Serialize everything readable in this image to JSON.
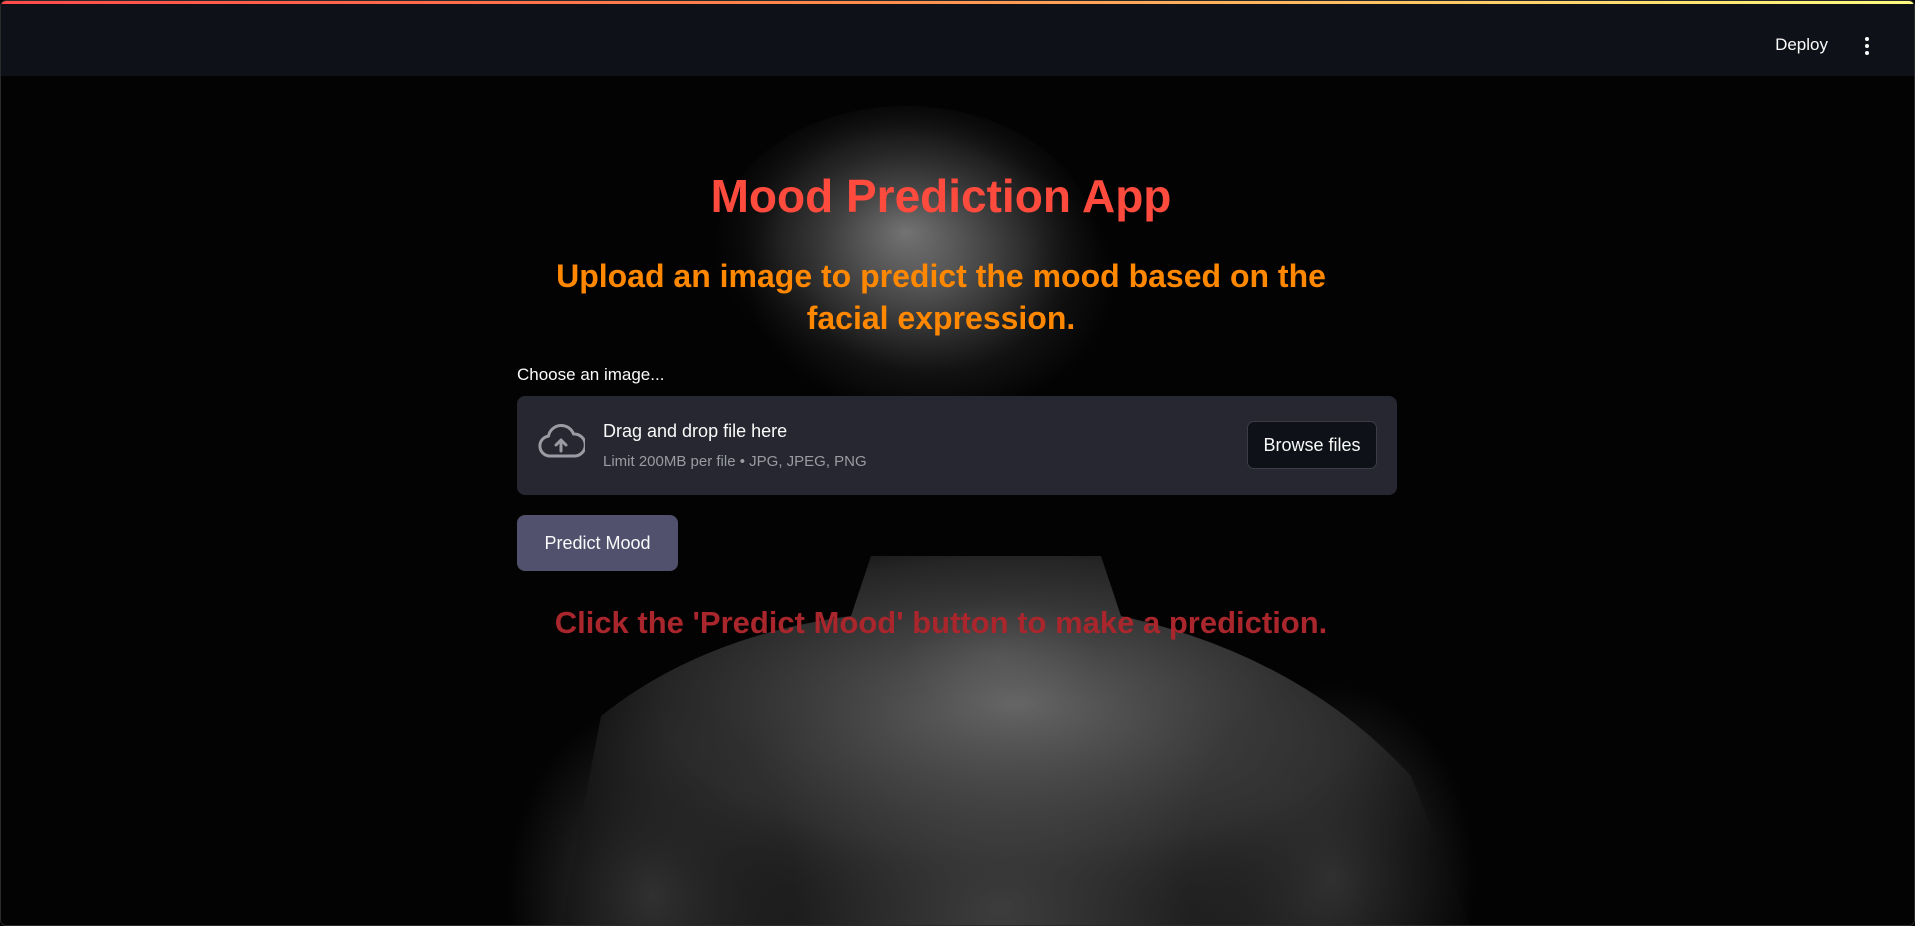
{
  "header": {
    "deploy_label": "Deploy",
    "menu_icon": "kebab-menu-icon"
  },
  "main": {
    "title": "Mood Prediction App",
    "subtitle": "Upload an image to predict the mood based on the facial expression.",
    "uploader": {
      "label": "Choose an image...",
      "drop_text": "Drag and drop file here",
      "limit_text": "Limit 200MB per file • JPG, JPEG, PNG",
      "browse_label": "Browse files",
      "icon": "cloud-upload-icon"
    },
    "predict_button_label": "Predict Mood",
    "hint_text": "Click the 'Predict Mood' button to make a prediction."
  },
  "colors": {
    "title": "#ff4b3e",
    "subtitle": "#ff8800",
    "hint": "#a8262c",
    "header_bg": "#0e1117",
    "dropzone_bg": "#262730",
    "predict_button_bg": "#51516e"
  }
}
